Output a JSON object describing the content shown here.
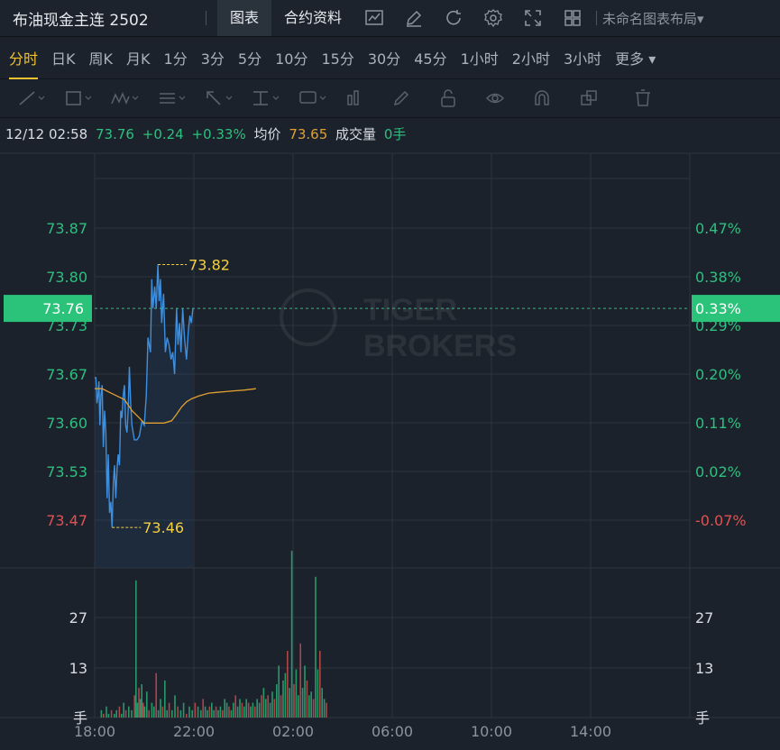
{
  "header": {
    "title": "布油现金主连 2502",
    "tabs": [
      {
        "label": "图表",
        "active": true
      },
      {
        "label": "合约资料",
        "active": false
      }
    ],
    "tools": [
      "line-chart-icon",
      "draw-pen-icon",
      "refresh-icon",
      "settings-gear-icon",
      "fullscreen-icon",
      "grid-layout-icon"
    ],
    "layout_name": "未命名图表布局"
  },
  "timeframes": [
    {
      "label": "分时",
      "active": true
    },
    {
      "label": "日K"
    },
    {
      "label": "周K"
    },
    {
      "label": "月K"
    },
    {
      "label": "1分"
    },
    {
      "label": "3分"
    },
    {
      "label": "5分"
    },
    {
      "label": "10分"
    },
    {
      "label": "15分"
    },
    {
      "label": "30分"
    },
    {
      "label": "45分"
    },
    {
      "label": "1小时"
    },
    {
      "label": "2小时"
    },
    {
      "label": "3小时"
    },
    {
      "label": "更多 ▾"
    }
  ],
  "drawing_tools": [
    "trend-line-icon",
    "rectangle-icon",
    "pattern-icon",
    "text-list-icon",
    "arrow-icon",
    "level-icon",
    "label-icon",
    "bar-icon",
    "brush-icon",
    "lock-icon",
    "eye-icon",
    "magnet-icon",
    "layers-icon",
    "trash-icon"
  ],
  "quote": {
    "datetime": "12/12 02:58",
    "price": "73.76",
    "change": "+0.24",
    "change_pct": "+0.33%",
    "avg_label": "均价",
    "avg_value": "73.65",
    "volume_label": "成交量",
    "volume_value": "0手"
  },
  "colors": {
    "up": "#2fbf7f",
    "down": "#e05252",
    "price_line": "#3d8fe0",
    "avg_line": "#e0a030",
    "highlight": "#f4d03f",
    "current_price_bg": "#2bc27a"
  },
  "chart_data": {
    "type": "line",
    "x_ticks": [
      "18:00",
      "22:00",
      "02:00",
      "06:00",
      "10:00",
      "14:00"
    ],
    "price_ticks": [
      "73.87",
      "73.80",
      "73.73",
      "73.67",
      "73.60",
      "73.53",
      "73.47"
    ],
    "pct_ticks": [
      "0.47%",
      "0.38%",
      "0.29%",
      "0.20%",
      "0.11%",
      "0.02%",
      "-0.07%"
    ],
    "current_price": "73.76",
    "current_pct": "0.33%",
    "high_label": "73.82",
    "low_label": "73.46",
    "volume_ticks": [
      "27",
      "13"
    ],
    "volume_unit": "手",
    "price_series": [
      [
        0,
        73.665
      ],
      [
        0.05,
        73.665
      ],
      [
        0.09,
        73.63
      ],
      [
        0.13,
        73.64
      ],
      [
        0.17,
        73.66
      ],
      [
        0.21,
        73.6
      ],
      [
        0.25,
        73.64
      ],
      [
        0.3,
        73.655
      ],
      [
        0.35,
        73.57
      ],
      [
        0.4,
        73.62
      ],
      [
        0.45,
        73.59
      ],
      [
        0.5,
        73.5
      ],
      [
        0.55,
        73.56
      ],
      [
        0.6,
        73.48
      ],
      [
        0.65,
        73.495
      ],
      [
        0.7,
        73.46
      ],
      [
        0.75,
        73.52
      ],
      [
        0.8,
        73.545
      ],
      [
        0.85,
        73.5
      ],
      [
        0.9,
        73.54
      ],
      [
        0.95,
        73.56
      ],
      [
        1.0,
        73.545
      ],
      [
        1.05,
        73.62
      ],
      [
        1.1,
        73.61
      ],
      [
        1.15,
        73.64
      ],
      [
        1.2,
        73.655
      ],
      [
        1.25,
        73.6
      ],
      [
        1.3,
        73.59
      ],
      [
        1.35,
        73.62
      ],
      [
        1.4,
        73.68
      ],
      [
        1.45,
        73.63
      ],
      [
        1.5,
        73.6
      ],
      [
        1.6,
        73.58
      ],
      [
        1.7,
        73.58
      ],
      [
        1.8,
        73.585
      ],
      [
        1.9,
        73.605
      ],
      [
        2.0,
        73.6
      ],
      [
        2.08,
        73.64
      ],
      [
        2.15,
        73.72
      ],
      [
        2.25,
        73.7
      ],
      [
        2.3,
        73.8
      ],
      [
        2.35,
        73.76
      ],
      [
        2.42,
        73.79
      ],
      [
        2.48,
        73.76
      ],
      [
        2.55,
        73.82
      ],
      [
        2.6,
        73.77
      ],
      [
        2.65,
        73.8
      ],
      [
        2.7,
        73.74
      ],
      [
        2.78,
        73.78
      ],
      [
        2.85,
        73.7
      ],
      [
        2.92,
        73.72
      ],
      [
        3.0,
        73.71
      ],
      [
        3.08,
        73.69
      ],
      [
        3.15,
        73.7
      ],
      [
        3.22,
        73.67
      ],
      [
        3.3,
        73.76
      ],
      [
        3.36,
        73.71
      ],
      [
        3.42,
        73.74
      ],
      [
        3.48,
        73.7
      ],
      [
        3.55,
        73.76
      ],
      [
        3.62,
        73.72
      ],
      [
        3.7,
        73.69
      ],
      [
        3.78,
        73.73
      ],
      [
        3.84,
        73.75
      ],
      [
        3.9,
        73.74
      ],
      [
        3.96,
        73.76
      ]
    ],
    "avg_series": [
      [
        0,
        73.65
      ],
      [
        0.3,
        73.65
      ],
      [
        0.6,
        73.645
      ],
      [
        0.9,
        73.64
      ],
      [
        1.2,
        73.635
      ],
      [
        1.5,
        73.62
      ],
      [
        1.8,
        73.61
      ],
      [
        2.0,
        73.603
      ],
      [
        2.4,
        73.603
      ],
      [
        2.8,
        73.603
      ],
      [
        3.1,
        73.606
      ],
      [
        3.3,
        73.615
      ],
      [
        3.5,
        73.625
      ],
      [
        3.7,
        73.632
      ],
      [
        3.9,
        73.636
      ],
      [
        4.2,
        73.64
      ],
      [
        4.6,
        73.644
      ],
      [
        4.9,
        73.645
      ],
      [
        5.3,
        73.646
      ],
      [
        5.6,
        73.647
      ],
      [
        6.0,
        73.648
      ],
      [
        6.5,
        73.65
      ]
    ],
    "volume_series": [
      [
        0.2,
        2
      ],
      [
        0.5,
        1
      ],
      [
        0.9,
        3
      ],
      [
        1.2,
        1
      ],
      [
        1.6,
        2
      ],
      [
        2.0,
        1
      ],
      [
        2.3,
        2
      ],
      [
        2.7,
        3
      ],
      [
        3.0,
        1
      ],
      [
        3.3,
        4
      ],
      [
        3.6,
        2
      ],
      [
        4.0,
        3
      ],
      [
        4.4,
        2
      ],
      [
        4.8,
        6
      ],
      [
        5.0,
        37
      ],
      [
        5.2,
        4
      ],
      [
        5.4,
        8
      ],
      [
        5.6,
        5
      ],
      [
        5.8,
        9
      ],
      [
        6.0,
        4
      ],
      [
        6.2,
        3
      ],
      [
        6.5,
        7
      ],
      [
        6.8,
        2
      ],
      [
        7.2,
        4
      ],
      [
        7.5,
        3
      ],
      [
        7.8,
        12
      ],
      [
        8.1,
        2
      ],
      [
        8.4,
        5
      ],
      [
        8.7,
        3
      ],
      [
        9.0,
        10
      ],
      [
        9.3,
        2
      ],
      [
        9.6,
        4
      ],
      [
        10.0,
        2
      ],
      [
        10.4,
        6
      ],
      [
        10.8,
        3
      ],
      [
        11.2,
        2
      ],
      [
        11.6,
        4
      ],
      [
        12.0,
        1
      ],
      [
        12.4,
        3
      ],
      [
        12.8,
        2
      ],
      [
        13.2,
        4
      ],
      [
        13.6,
        3
      ],
      [
        14.0,
        2
      ],
      [
        14.3,
        5
      ],
      [
        14.6,
        3
      ],
      [
        14.9,
        2
      ],
      [
        15.2,
        3
      ],
      [
        15.5,
        4
      ],
      [
        15.8,
        2
      ],
      [
        16.1,
        3
      ],
      [
        16.4,
        2
      ],
      [
        16.7,
        3
      ],
      [
        17.0,
        2
      ],
      [
        17.3,
        5
      ],
      [
        17.6,
        4
      ],
      [
        17.9,
        3
      ],
      [
        18.2,
        2
      ],
      [
        18.5,
        4
      ],
      [
        18.8,
        6
      ],
      [
        19.1,
        3
      ],
      [
        19.4,
        5
      ],
      [
        19.7,
        4
      ],
      [
        20.0,
        3
      ],
      [
        20.3,
        5
      ],
      [
        20.6,
        4
      ],
      [
        20.9,
        3
      ],
      [
        21.2,
        4
      ],
      [
        21.5,
        3
      ],
      [
        21.8,
        5
      ],
      [
        22.1,
        4
      ],
      [
        22.4,
        6
      ],
      [
        22.7,
        8
      ],
      [
        23.0,
        5
      ],
      [
        23.3,
        6
      ],
      [
        23.6,
        4
      ],
      [
        23.9,
        7
      ],
      [
        24.2,
        5
      ],
      [
        24.5,
        9
      ],
      [
        24.8,
        14
      ],
      [
        25.1,
        6
      ],
      [
        25.4,
        10
      ],
      [
        25.7,
        12
      ],
      [
        26.0,
        18
      ],
      [
        26.3,
        8
      ],
      [
        26.6,
        45
      ],
      [
        26.9,
        9
      ],
      [
        27.2,
        13
      ],
      [
        27.5,
        6
      ],
      [
        27.8,
        20
      ],
      [
        28.1,
        8
      ],
      [
        28.4,
        14
      ],
      [
        28.7,
        10
      ],
      [
        29.0,
        6
      ],
      [
        29.3,
        7
      ],
      [
        29.6,
        5
      ],
      [
        29.9,
        38
      ],
      [
        30.2,
        13
      ],
      [
        30.5,
        18
      ],
      [
        30.8,
        8
      ],
      [
        31.1,
        5
      ],
      [
        31.4,
        4
      ]
    ],
    "note_volume_x_scale": "volume x values are in 5-minute steps from 18:00 (0) onward"
  }
}
